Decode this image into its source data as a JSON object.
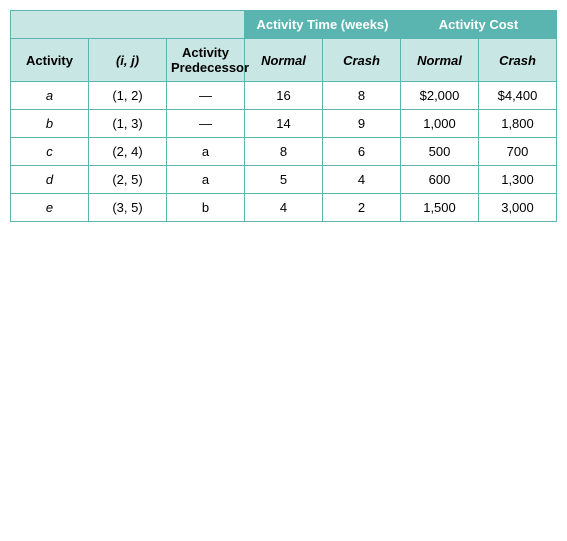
{
  "table": {
    "headers": {
      "top_left_span": "",
      "activity_time_label": "Activity Time (weeks)",
      "activity_cost_label": "Activity Cost",
      "col_activity": "Activity",
      "col_ij": "(i, j)",
      "col_predecessor": "Activity Predecessor",
      "col_normal_time": "Normal",
      "col_crash_time": "Crash",
      "col_normal_cost": "Normal",
      "col_crash_cost": "Crash"
    },
    "rows": [
      {
        "activity": "a",
        "ij": "(1, 2)",
        "predecessor": "—",
        "normal_time": "16",
        "crash_time": "8",
        "normal_cost": "$2,000",
        "crash_cost": "$4,400"
      },
      {
        "activity": "b",
        "ij": "(1, 3)",
        "predecessor": "—",
        "normal_time": "14",
        "crash_time": "9",
        "normal_cost": "1,000",
        "crash_cost": "1,800"
      },
      {
        "activity": "c",
        "ij": "(2, 4)",
        "predecessor": "a",
        "normal_time": "8",
        "crash_time": "6",
        "normal_cost": "500",
        "crash_cost": "700"
      },
      {
        "activity": "d",
        "ij": "(2, 5)",
        "predecessor": "a",
        "normal_time": "5",
        "crash_time": "4",
        "normal_cost": "600",
        "crash_cost": "1,300"
      },
      {
        "activity": "e",
        "ij": "(3, 5)",
        "predecessor": "b",
        "normal_time": "4",
        "crash_time": "2",
        "normal_cost": "1,500",
        "crash_cost": "3,000"
      }
    ]
  }
}
